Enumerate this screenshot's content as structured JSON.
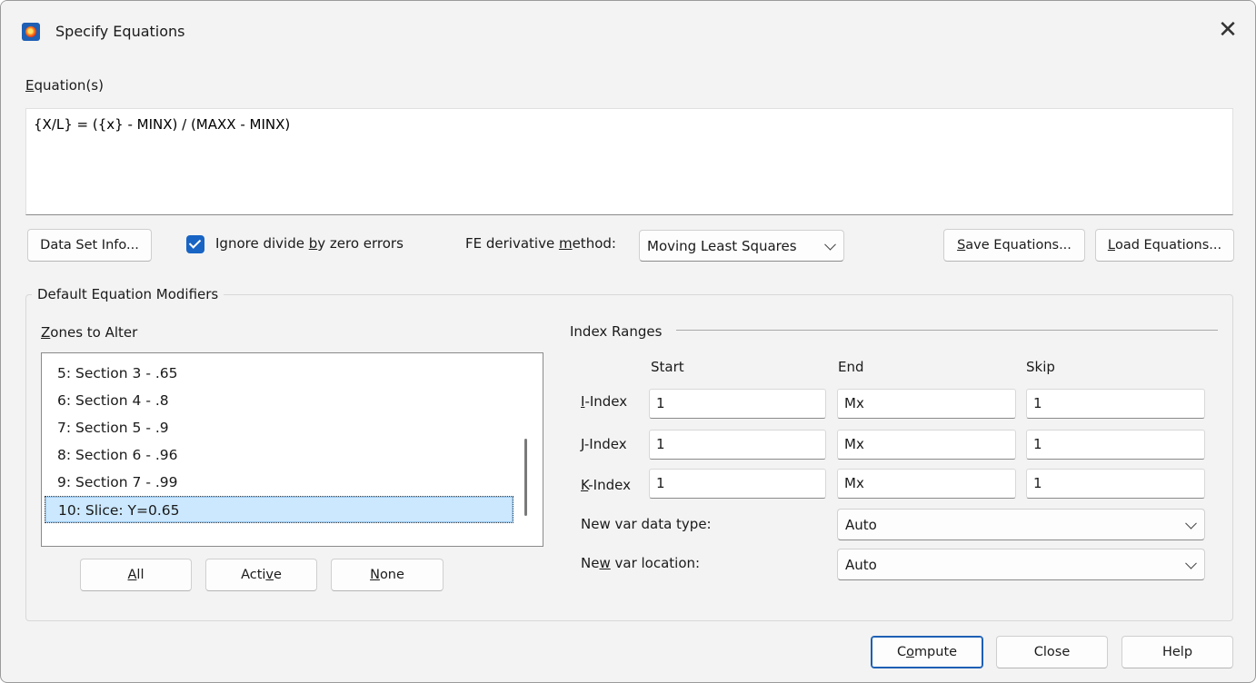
{
  "window": {
    "title": "Specify Equations",
    "close_glyph": "✕"
  },
  "equations": {
    "label_pre": "",
    "label_u": "E",
    "label_post": "quation(s)",
    "text": "{X/L} = ({x} - MINX) / (MAXX - MINX)"
  },
  "toolbar": {
    "data_set_info_label": "Data Set Info...",
    "ignore_pre": "Ignore divide ",
    "ignore_u": "b",
    "ignore_post": "y zero errors",
    "ignore_checked": true,
    "fe_pre": "FE derivative ",
    "fe_u": "m",
    "fe_post": "ethod:",
    "fe_method_value": "Moving Least Squares",
    "save_u": "S",
    "save_post": "ave Equations...",
    "load_u": "L",
    "load_post": "oad Equations..."
  },
  "modifiers": {
    "group_title": "Default Equation Modifiers",
    "zones_u": "Z",
    "zones_post": "ones to Alter",
    "zones": [
      "5: Section  3 - .65",
      "6: Section  4 - .8",
      "7: Section  5 - .9",
      "8: Section  6 - .96",
      "9: Section  7 - .99",
      "10: Slice: Y=0.65"
    ],
    "selected_zone": "10: Slice: Y=0.65",
    "all_u": "A",
    "all_post": "ll",
    "active_pre": "Acti",
    "active_u": "v",
    "active_post": "e",
    "none_u": "N",
    "none_post": "one",
    "index_ranges_title": "Index Ranges",
    "col_start": "Start",
    "col_end": "End",
    "col_skip": "Skip",
    "i_u": "I",
    "i_post": "-Index",
    "j_u": "J",
    "j_post": "-Index",
    "k_u": "K",
    "k_post": "-Index",
    "i_start": "1",
    "i_end": "Mx",
    "i_skip": "1",
    "j_start": "1",
    "j_end": "Mx",
    "j_skip": "1",
    "k_start": "1",
    "k_end": "Mx",
    "k_skip": "1",
    "data_type_label": "New var data type:",
    "data_type_value": "Auto",
    "loc_pre": "Ne",
    "loc_u": "w",
    "loc_post": " var location:",
    "location_value": "Auto"
  },
  "footer": {
    "compute_pre": "C",
    "compute_u": "o",
    "compute_post": "mpute",
    "close_label": "Close",
    "help_label": "Help"
  }
}
